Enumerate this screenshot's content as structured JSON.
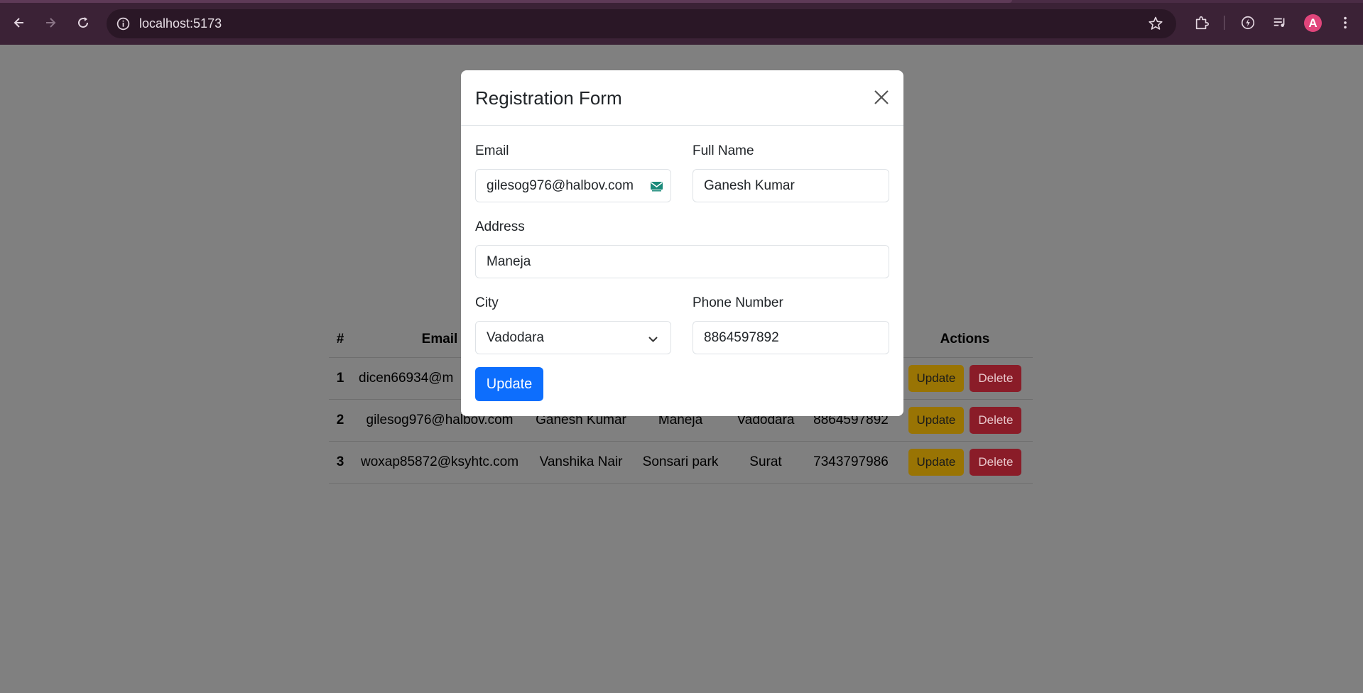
{
  "browser": {
    "url": "localhost:5173",
    "avatar_initial": "A"
  },
  "table": {
    "headers": [
      "#",
      "Email",
      "",
      "",
      "",
      "",
      "Actions"
    ],
    "rows": [
      {
        "index": "1",
        "email": "dicen66934@m",
        "name": "",
        "address": "",
        "city": "",
        "phone": "",
        "update": "Update",
        "delete": "Delete"
      },
      {
        "index": "2",
        "email": "gilesog976@halbov.com",
        "name": "Ganesh Kumar",
        "address": "Maneja",
        "city": "Vadodara",
        "phone": "8864597892",
        "update": "Update",
        "delete": "Delete"
      },
      {
        "index": "3",
        "email": "woxap85872@ksyhtc.com",
        "name": "Vanshika Nair",
        "address": "Sonsari park",
        "city": "Surat",
        "phone": "7343797986",
        "update": "Update",
        "delete": "Delete"
      }
    ]
  },
  "modal": {
    "title": "Registration Form",
    "email_label": "Email",
    "email_value": "gilesog976@halbov.com",
    "fullname_label": "Full Name",
    "fullname_value": "Ganesh Kumar",
    "address_label": "Address",
    "address_value": "Maneja",
    "city_label": "City",
    "city_value": "Vadodara",
    "phone_label": "Phone Number",
    "phone_value": "8864597892",
    "submit_label": "Update"
  },
  "colors": {
    "primary": "#0d6efd",
    "warning": "#997404",
    "danger": "#8a1c28",
    "browser_frame": "#3b2236"
  }
}
